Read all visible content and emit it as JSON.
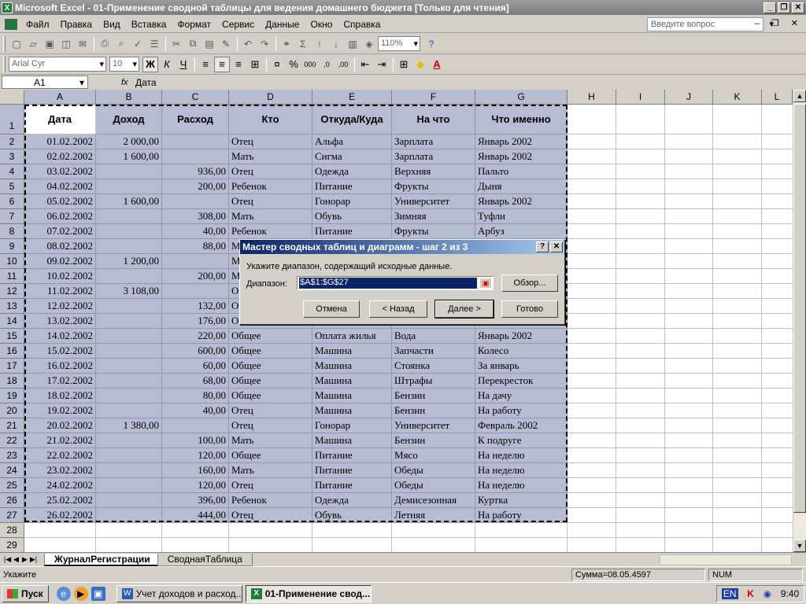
{
  "window": {
    "title": "Microsoft Excel - 01-Применение сводной таблицы для ведения домашнего бюджета  [Только для чтения]"
  },
  "menu": {
    "items": [
      "Файл",
      "Правка",
      "Вид",
      "Вставка",
      "Формат",
      "Сервис",
      "Данные",
      "Окно",
      "Справка"
    ],
    "ask_placeholder": "Введите вопрос"
  },
  "toolbar": {
    "zoom": "110%",
    "font": "Arial Cyr",
    "size": "10",
    "bold": "Ж",
    "italic": "К",
    "underline": "Ч"
  },
  "formula": {
    "namebox": "A1",
    "fx": "fx",
    "content": "Дата"
  },
  "columns": [
    "A",
    "B",
    "C",
    "D",
    "E",
    "F",
    "G",
    "H",
    "I",
    "J",
    "K",
    "L"
  ],
  "header_row": [
    "Дата",
    "Доход",
    "Расход",
    "Кто",
    "Откуда/Куда",
    "На что",
    "Что именно"
  ],
  "rows": [
    [
      "01.02.2002",
      "2 000,00",
      "",
      "Отец",
      "Альфа",
      "Зарплата",
      "Январь 2002"
    ],
    [
      "02.02.2002",
      "1 600,00",
      "",
      "Мать",
      "Сигма",
      "Зарплата",
      "Январь 2002"
    ],
    [
      "03.02.2002",
      "",
      "936,00",
      "Отец",
      "Одежда",
      "Верхняя",
      "Пальто"
    ],
    [
      "04.02.2002",
      "",
      "200,00",
      "Ребенок",
      "Питание",
      "Фрукты",
      "Дыня"
    ],
    [
      "05.02.2002",
      "1 600,00",
      "",
      "Отец",
      "Гонорар",
      "Университет",
      "Январь 2002"
    ],
    [
      "06.02.2002",
      "",
      "308,00",
      "Мать",
      "Обувь",
      "Зимняя",
      "Туфли"
    ],
    [
      "07.02.2002",
      "",
      "40,00",
      "Ребенок",
      "Питание",
      "Фрукты",
      "Арбуз"
    ],
    [
      "08.02.2002",
      "",
      "88,00",
      "М",
      "",
      "",
      ""
    ],
    [
      "09.02.2002",
      "1 200,00",
      "",
      "М",
      "",
      "",
      ""
    ],
    [
      "10.02.2002",
      "",
      "200,00",
      "М",
      "",
      "",
      ""
    ],
    [
      "11.02.2002",
      "3 108,00",
      "",
      "О",
      "",
      "",
      ""
    ],
    [
      "12.02.2002",
      "",
      "132,00",
      "О",
      "",
      "",
      ""
    ],
    [
      "13.02.2002",
      "",
      "176,00",
      "О",
      "",
      "",
      ""
    ],
    [
      "14.02.2002",
      "",
      "220,00",
      "Общее",
      "Оплата жилья",
      "Вода",
      "Январь 2002"
    ],
    [
      "15.02.2002",
      "",
      "600,00",
      "Общее",
      "Машина",
      "Запчасти",
      "Колесо"
    ],
    [
      "16.02.2002",
      "",
      "60,00",
      "Общее",
      "Машина",
      "Стоянка",
      "За январь"
    ],
    [
      "17.02.2002",
      "",
      "68,00",
      "Общее",
      "Машина",
      "Штрафы",
      "Перекресток"
    ],
    [
      "18.02.2002",
      "",
      "80,00",
      "Общее",
      "Машина",
      "Бензин",
      "На дачу"
    ],
    [
      "19.02.2002",
      "",
      "40,00",
      "Отец",
      "Машина",
      "Бензин",
      "На работу"
    ],
    [
      "20.02.2002",
      "1 380,00",
      "",
      "Отец",
      "Гонорар",
      "Университет",
      "Февраль 2002"
    ],
    [
      "21.02.2002",
      "",
      "100,00",
      "Мать",
      "Машина",
      "Бензин",
      "К подруге"
    ],
    [
      "22.02.2002",
      "",
      "120,00",
      "Общее",
      "Питание",
      "Мясо",
      "На неделю"
    ],
    [
      "23.02.2002",
      "",
      "160,00",
      "Мать",
      "Питание",
      "Обеды",
      "На неделю"
    ],
    [
      "24.02.2002",
      "",
      "120,00",
      "Отец",
      "Питание",
      "Обеды",
      "На неделю"
    ],
    [
      "25.02.2002",
      "",
      "396,00",
      "Ребенок",
      "Одежда",
      "Демисезонная",
      "Куртка"
    ],
    [
      "26.02.2002",
      "",
      "444,00",
      "Отец",
      "Обувь",
      "Летняя",
      "На работу"
    ]
  ],
  "row_numbers": [
    "1",
    "2",
    "3",
    "4",
    "5",
    "6",
    "7",
    "8",
    "9",
    "10",
    "11",
    "12",
    "13",
    "14",
    "15",
    "16",
    "17",
    "18",
    "19",
    "20",
    "21",
    "22",
    "23",
    "24",
    "25",
    "26",
    "27",
    "28",
    "29"
  ],
  "sheets": [
    "ЖурналРегистрации",
    "СводнаяТаблица"
  ],
  "status": {
    "left": "Укажите",
    "sum": "Сумма=08.05.4597",
    "num": "NUM"
  },
  "dialog": {
    "title": "Мастер сводных таблиц и диаграмм - шаг 2 из 3",
    "help": "?",
    "close": "✕",
    "instruction": "Укажите диапазон, содержащий исходные данные.",
    "range_label": "Диапазон:",
    "range_value": "$A$1:$G$27",
    "browse": "Обзор...",
    "cancel": "Отмена",
    "back": "< Назад",
    "next": "Далее >",
    "finish": "Готово"
  },
  "taskbar": {
    "start": "Пуск",
    "tasks": [
      "Учет доходов и расход...",
      "01-Применение свод..."
    ],
    "lang": "EN",
    "clock": "9:40"
  }
}
